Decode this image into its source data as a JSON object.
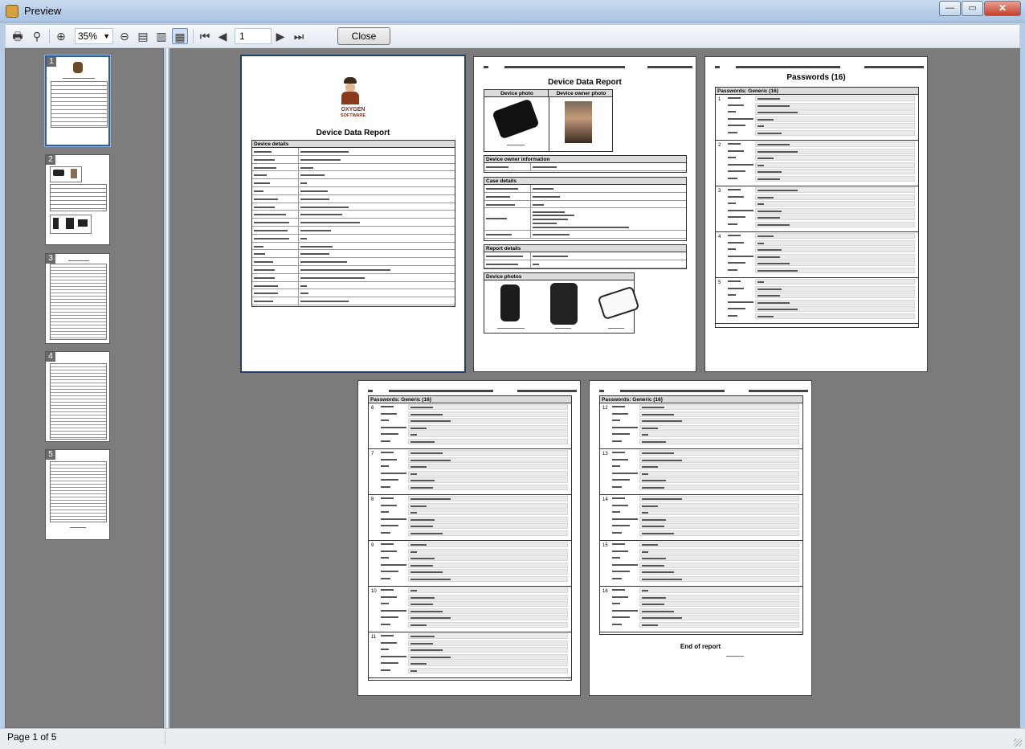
{
  "window": {
    "title": "Preview",
    "controls": {
      "minimize": "—",
      "maximize": "▭",
      "close": "✕"
    }
  },
  "toolbar": {
    "print_icon": "printer-icon",
    "find_icon": "binoculars-icon",
    "zoom_in_icon": "zoom-in-icon",
    "zoom_value": "35%",
    "zoom_out_icon": "zoom-out-icon",
    "page_value": "1",
    "close_label": "Close"
  },
  "thumbnails": [
    {
      "number": "1",
      "selected": true
    },
    {
      "number": "2",
      "selected": false
    },
    {
      "number": "3",
      "selected": false
    },
    {
      "number": "4",
      "selected": false
    },
    {
      "number": "5",
      "selected": false
    }
  ],
  "pages": {
    "page1": {
      "logo_line1": "OXYGEN",
      "logo_line2": "SOFTWARE",
      "title": "Device Data Report",
      "section": "Device details"
    },
    "page2": {
      "title": "Device Data Report",
      "col1": "Device photo",
      "col2": "Device owner photo",
      "owner_section": "Device owner information",
      "case_section": "Case details",
      "report_section": "Report details",
      "photos_section": "Device photos"
    },
    "page3": {
      "title": "Passwords (16)",
      "section": "Passwords: Generic (16)",
      "entries": [
        "1",
        "2",
        "3",
        "4",
        "5"
      ]
    },
    "page4": {
      "section": "Passwords: Generic (16)",
      "entries": [
        "6",
        "7",
        "8",
        "9",
        "10",
        "11"
      ]
    },
    "page5": {
      "section": "Passwords: Generic (16)",
      "entries": [
        "12",
        "13",
        "14",
        "15",
        "16"
      ],
      "end_label": "End of report"
    }
  },
  "statusbar": {
    "page_indicator": "Page 1 of 5"
  }
}
